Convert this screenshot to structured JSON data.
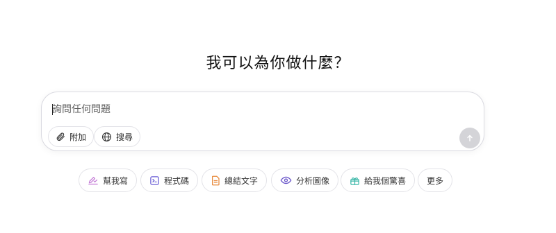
{
  "headline": "我可以為你做什麼？",
  "composer": {
    "input_value": "",
    "placeholder": "詢問任何問題",
    "attach_label": "附加",
    "search_label": "搜尋"
  },
  "suggestions": [
    {
      "label": "幫我寫",
      "icon": "pen-icon",
      "color": "#c37bd6"
    },
    {
      "label": "程式碼",
      "icon": "terminal-icon",
      "color": "#6b5fd6"
    },
    {
      "label": "總結文字",
      "icon": "document-icon",
      "color": "#e8893a"
    },
    {
      "label": "分析圖像",
      "icon": "eye-icon",
      "color": "#6a56c9"
    },
    {
      "label": "給我個驚喜",
      "icon": "gift-icon",
      "color": "#3bb7a8"
    },
    {
      "label": "更多",
      "icon": "",
      "color": ""
    }
  ],
  "colors": {
    "send_button_disabled": "#d4d4d8",
    "border": "#d9d9e0"
  }
}
